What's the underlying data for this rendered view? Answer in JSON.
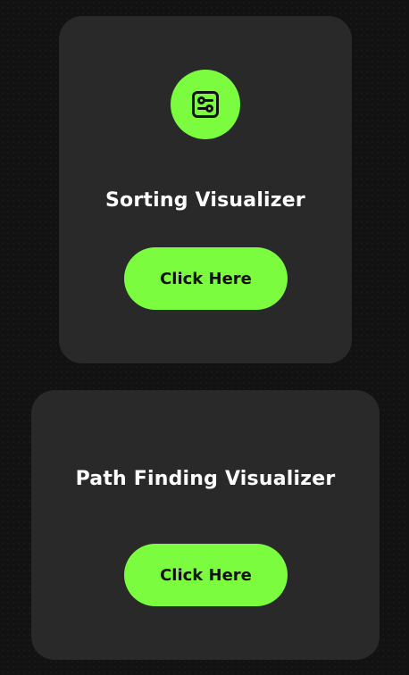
{
  "colors": {
    "background": "#121212",
    "card": "#292929",
    "accent": "#7cfc3f",
    "title_text": "#ffffff",
    "button_text": "#111111"
  },
  "cards": [
    {
      "icon": "sliders-icon",
      "title": "Sorting Visualizer",
      "button_label": "Click Here"
    },
    {
      "title": "Path Finding Visualizer",
      "button_label": "Click Here"
    }
  ]
}
